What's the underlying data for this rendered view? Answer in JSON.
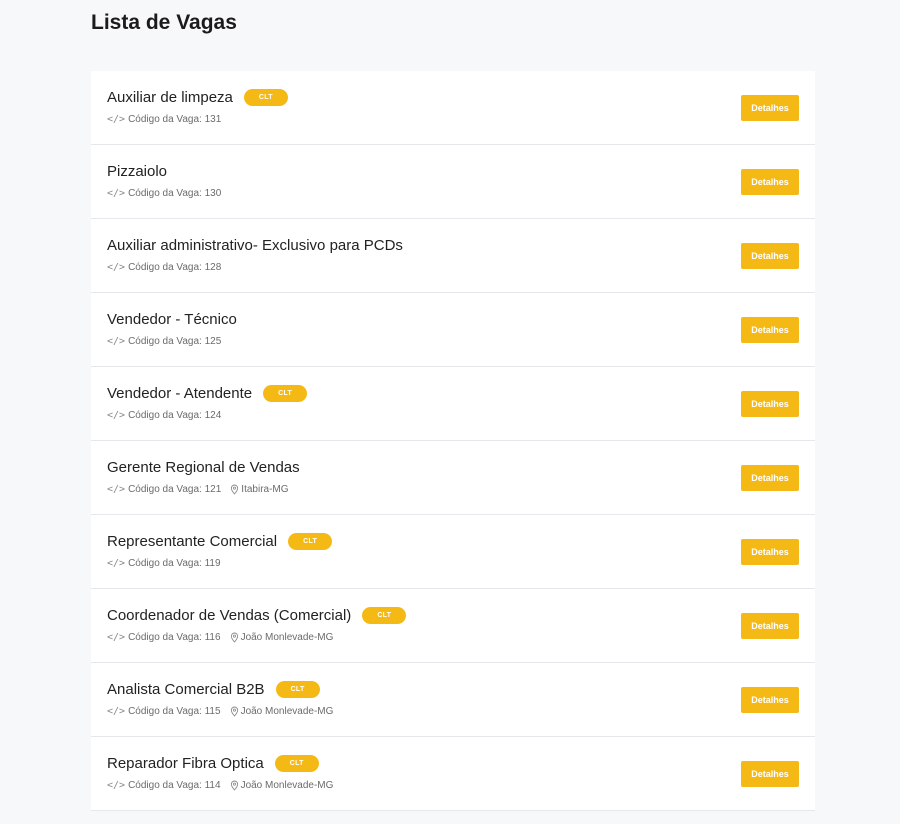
{
  "page": {
    "title": "Lista de Vagas"
  },
  "labels": {
    "code_prefix": "Código da Vaga:",
    "details_button": "Detalhes",
    "clt_badge": "CLT"
  },
  "colors": {
    "accent": "#f5b916",
    "background": "#f7f8fa",
    "card": "#ffffff"
  },
  "jobs": [
    {
      "title": "Auxiliar de limpeza",
      "clt": "CLT",
      "code": "131",
      "location": null
    },
    {
      "title": "Pizzaiolo",
      "clt": null,
      "code": "130",
      "location": null
    },
    {
      "title": "Auxiliar administrativo- Exclusivo para PCDs",
      "clt": null,
      "code": "128",
      "location": null
    },
    {
      "title": "Vendedor - Técnico",
      "clt": null,
      "code": "125",
      "location": null
    },
    {
      "title": "Vendedor - Atendente",
      "clt": "CLT",
      "code": "124",
      "location": null
    },
    {
      "title": "Gerente Regional de Vendas",
      "clt": null,
      "code": "121",
      "location": "Itabira-MG"
    },
    {
      "title": "Representante Comercial",
      "clt": "CLT",
      "code": "119",
      "location": null
    },
    {
      "title": "Coordenador de Vendas (Comercial)",
      "clt": "CLT",
      "code": "116",
      "location": "João Monlevade-MG"
    },
    {
      "title": "Analista Comercial B2B",
      "clt": "CLT",
      "code": "115",
      "location": "João Monlevade-MG"
    },
    {
      "title": "Reparador Fibra Optica",
      "clt": "CLT",
      "code": "114",
      "location": "João Monlevade-MG"
    }
  ]
}
